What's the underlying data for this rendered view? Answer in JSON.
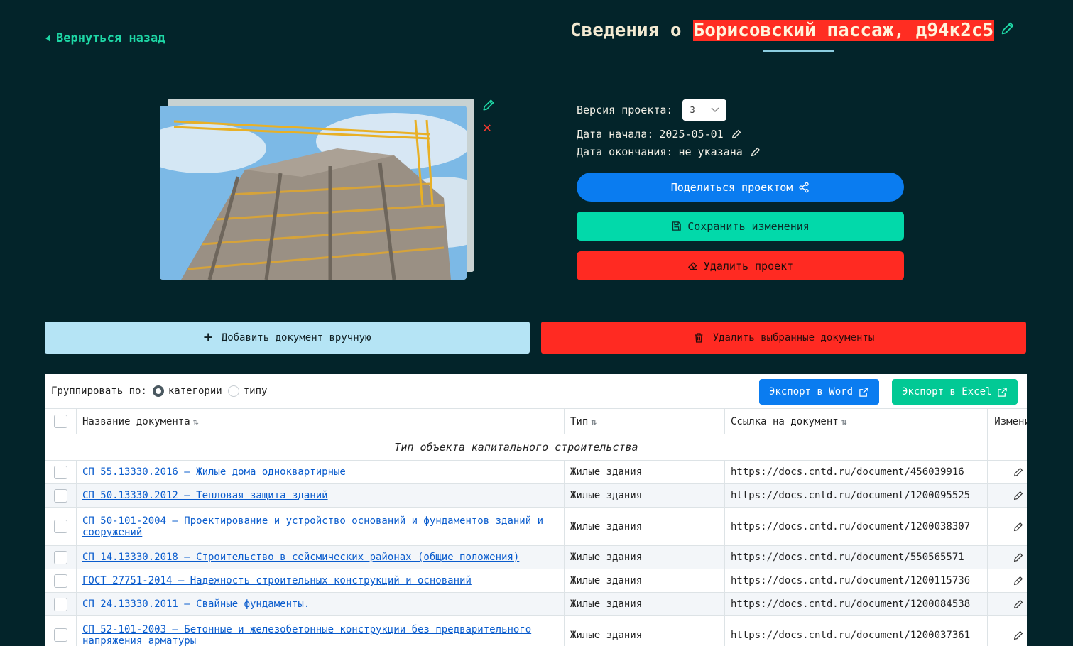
{
  "nav": {
    "back_label": "Вернуться назад"
  },
  "header": {
    "title_prefix": "Сведения о",
    "project_name": "Борисовский пассаж, д94к2с5"
  },
  "project": {
    "version_label": "Версия проекта:",
    "version_value": "3",
    "start_label": "Дата начала:",
    "start_value": "2025-05-01",
    "end_label": "Дата окончания:",
    "end_value": "не указана"
  },
  "actions": {
    "share_label": "Поделиться проектом",
    "save_label": "Сохранить изменения",
    "delete_label": "Удалить проект",
    "add_doc_label": "Добавить документ вручную",
    "delete_selected_label": "Удалить выбранные документы"
  },
  "table_toolbar": {
    "group_by_label": "Группировать по:",
    "group_options": [
      "категории",
      "типу"
    ],
    "group_selected": "категории",
    "export_word_label": "Экспорт в Word",
    "export_excel_label": "Экспорт в Excel"
  },
  "columns": {
    "name": "Название документа",
    "type": "Тип",
    "link": "Ссылка на документ",
    "edit": "Изменить"
  },
  "group_title": "Тип объекта капитального строительства",
  "documents": [
    {
      "name": "СП 55.13330.2016 — Жилые дома одноквартирные",
      "type": "Жилые здания",
      "link": "https://docs.cntd.ru/document/456039916"
    },
    {
      "name": "СП 50.13330.2012 — Тепловая защита зданий",
      "type": "Жилые здания",
      "link": "https://docs.cntd.ru/document/1200095525"
    },
    {
      "name": "СП 50-101-2004 — Проектирование и устройство оснований и фундаментов зданий и сооружений",
      "type": "Жилые здания",
      "link": "https://docs.cntd.ru/document/1200038307"
    },
    {
      "name": "СП 14.13330.2018 — Строительство в сейсмических районах (общие положения)",
      "type": "Жилые здания",
      "link": "https://docs.cntd.ru/document/550565571"
    },
    {
      "name": "ГОСТ 27751-2014 — Надежность строительных конструкций и оснований",
      "type": "Жилые здания",
      "link": "https://docs.cntd.ru/document/1200115736"
    },
    {
      "name": "СП 24.13330.2011 — Свайные фундаменты.",
      "type": "Жилые здания",
      "link": "https://docs.cntd.ru/document/1200084538"
    },
    {
      "name": "СП 52-101-2003 — Бетонные и железобетонные конструкции без предварительного напряжения арматуры",
      "type": "Жилые здания",
      "link": "https://docs.cntd.ru/document/1200037361"
    }
  ],
  "colors": {
    "background": "#03242a",
    "accent_green": "#1ed8a6",
    "share_blue": "#0a7cf0",
    "save_green": "#02d9aa",
    "danger_red": "#ff2a22",
    "add_doc_blue": "#b5e4f5"
  },
  "icons": [
    "chevron-left-icon",
    "pencil-icon",
    "close-icon",
    "chevron-down-icon",
    "share-icon",
    "save-icon",
    "eraser-icon",
    "plus-icon",
    "trash-icon",
    "external-link-icon",
    "sort-icon"
  ]
}
